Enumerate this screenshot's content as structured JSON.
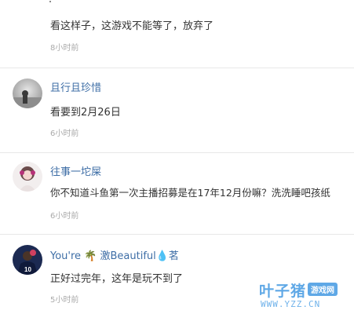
{
  "comments": [
    {
      "username": "",
      "content": "看这样子，这游戏不能等了，放弃了",
      "time": "8小时前"
    },
    {
      "username": "且行且珍惜",
      "content": "看要到2月26日",
      "time": "6小时前"
    },
    {
      "username": "往事一坨屎",
      "content": "你不知道斗鱼第一次主播招募是在17年12月份嘛？洗洗睡吧孩纸",
      "time": "6小时前"
    },
    {
      "username": "You're 🌴 激Beautiful💧茗",
      "content": "正好过完年，这年是玩不到了",
      "time": "5小时前"
    }
  ],
  "watermark": {
    "brand": "叶子猪",
    "tag": "游戏网",
    "url": "WWW.YZZ.CN"
  },
  "colors": {
    "username": "#3e6ea6",
    "time": "#aaaaaa",
    "watermark": "#5fa8e6"
  }
}
